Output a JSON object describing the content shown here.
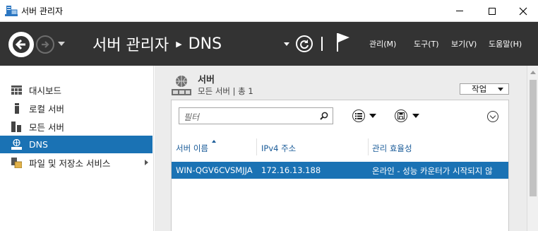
{
  "window": {
    "title": "서버 관리자"
  },
  "header": {
    "app_name": "서버 관리자",
    "current_page": "DNS",
    "menus": [
      {
        "label": "관리(M)"
      },
      {
        "label": "도구(T)"
      },
      {
        "label": "보기(V)"
      },
      {
        "label": "도움말(H)"
      }
    ]
  },
  "sidebar": {
    "items": [
      {
        "label": "대시보드",
        "icon": "dashboard-icon",
        "active": false
      },
      {
        "label": "로컬 서버",
        "icon": "local-server-icon",
        "active": false
      },
      {
        "label": "모든 서버",
        "icon": "all-servers-icon",
        "active": false
      },
      {
        "label": "DNS",
        "icon": "dns-icon",
        "active": true
      },
      {
        "label": "파일 및 저장소 서비스",
        "icon": "file-storage-icon",
        "active": false,
        "has_children": true
      }
    ]
  },
  "servers_section": {
    "title": "서버",
    "subtitle": "모든 서버 | 총 1",
    "tasks_label": "작업",
    "filter_placeholder": "필터",
    "columns": [
      "서버 이름",
      "IPv4 주소",
      "관리 효율성"
    ],
    "rows": [
      {
        "server_name": "WIN-QGV6CVSMJJA",
        "ipv4": "172.16.13.188",
        "manageability": "온라인 - 성능 카운터가 시작되지 않"
      }
    ]
  },
  "colors": {
    "header_bg": "#333333",
    "selection": "#1a72b4",
    "panel_bg": "#ececec",
    "column_header_text": "#1a5b98"
  }
}
